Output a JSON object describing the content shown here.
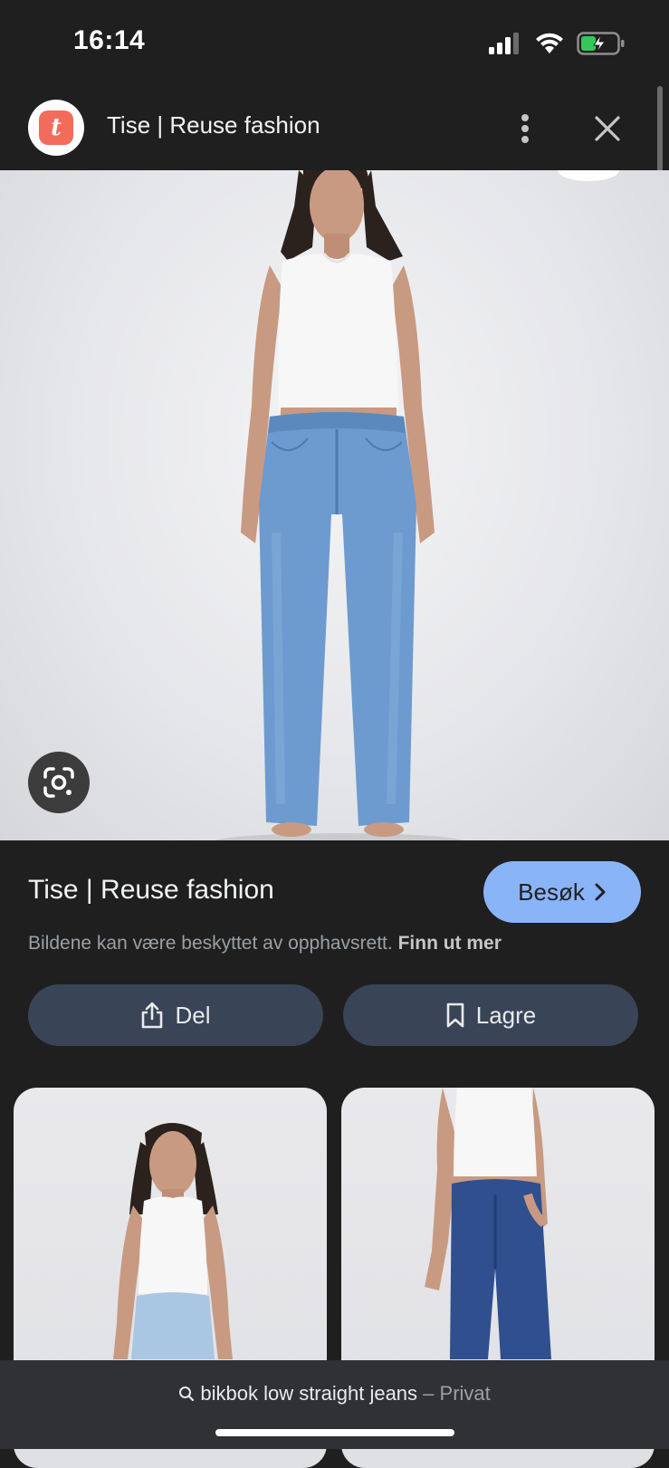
{
  "status_bar": {
    "time": "16:14"
  },
  "header": {
    "site_logo_letter": "t",
    "title": "Tise | Reuse fashion"
  },
  "result": {
    "title": "Tise | Reuse fashion",
    "visit_label": "Besøk",
    "copyright_text": "Bildene kan være beskyttet av opphavsrett.",
    "learn_more": "Finn ut mer"
  },
  "actions": {
    "share_label": "Del",
    "save_label": "Lagre"
  },
  "bottom": {
    "query": "bikbok low straight jeans",
    "separator": " – ",
    "mode": "Privat"
  },
  "colors": {
    "accent": "#8ab4f8",
    "button_bg": "#394457",
    "logo": "#f36b5a",
    "battery": "#34c759"
  }
}
